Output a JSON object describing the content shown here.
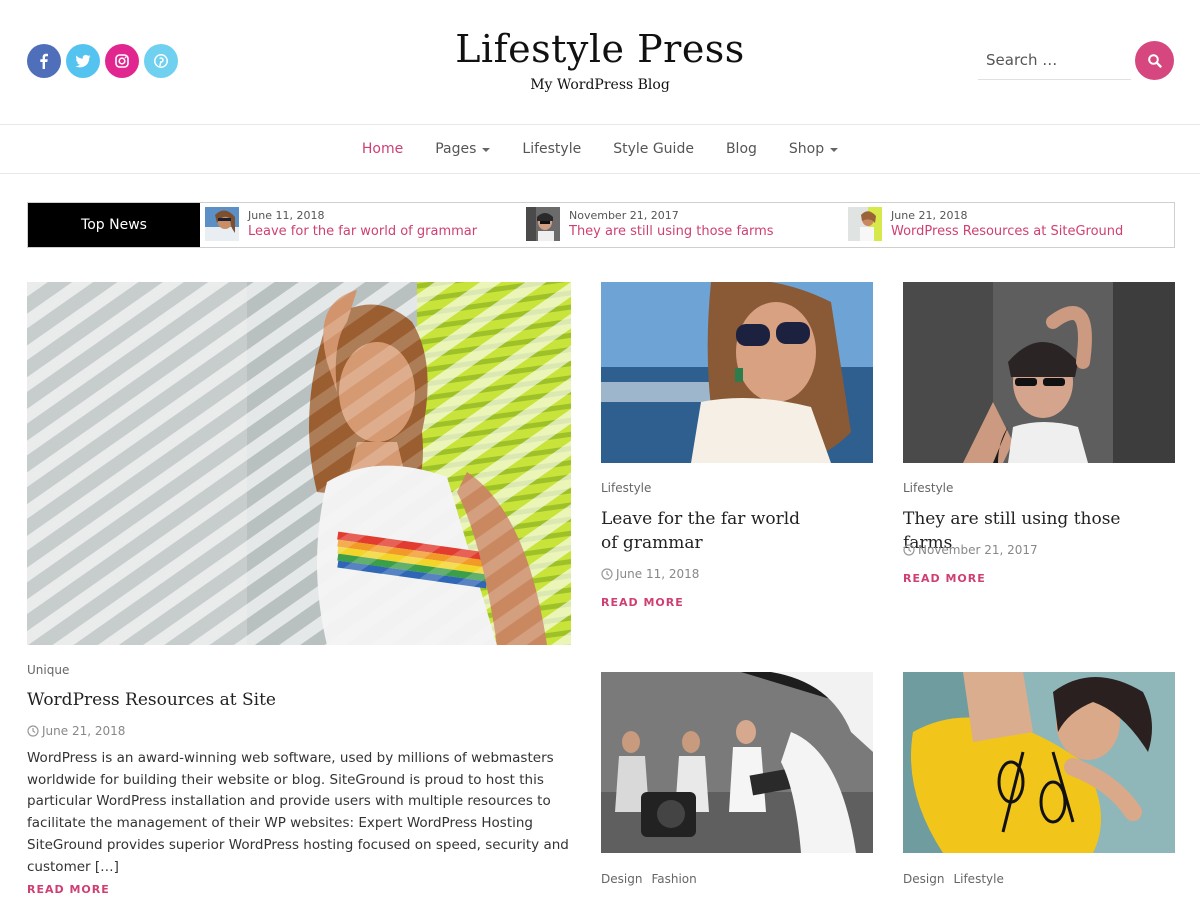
{
  "site": {
    "title": "Lifestyle Press",
    "tagline": "My WordPress Blog"
  },
  "social": [
    "facebook-icon",
    "twitter-icon",
    "instagram-icon",
    "pinterest-icon"
  ],
  "colors": {
    "accent": "#cf3f74",
    "facebook": "#4f6fba",
    "twitter": "#55c3f0",
    "instagram": "#e2268f",
    "pinterest": "#6fd0f0"
  },
  "search": {
    "placeholder": "Search …"
  },
  "nav": [
    "Home",
    "Pages",
    "Lifestyle",
    "Style Guide",
    "Blog",
    "Shop"
  ],
  "ticker": {
    "label": "Top News",
    "items": [
      {
        "date": "June 11, 2018",
        "title": "Leave for the far world of grammar"
      },
      {
        "date": "November 21, 2017",
        "title": "They are still using those farms"
      },
      {
        "date": "June 21, 2018",
        "title": "WordPress Resources at SiteGround"
      }
    ]
  },
  "posts": [
    {
      "category": "Unique",
      "title": "WordPress Resources at Site",
      "date": "June 21, 2018",
      "excerpt": "WordPress is an award-winning web software, used by millions of webmasters worldwide for building their website or blog. SiteGround is proud to host this particular WordPress installation and provide users with multiple resources to facilitate the management of their WP websites: Expert WordPress Hosting SiteGround provides superior WordPress hosting focused on speed, security and customer […]",
      "read_more": "READ MORE"
    },
    {
      "category": "Lifestyle",
      "title": "Leave for the far world of grammar",
      "date": "June 11, 2018",
      "read_more": "READ MORE"
    },
    {
      "category": "Lifestyle",
      "title": "They are still using those farms",
      "date": "November 21, 2017",
      "read_more": "READ MORE"
    },
    {
      "categories": [
        "Design",
        "Fashion"
      ]
    },
    {
      "categories": [
        "Design",
        "Lifestyle"
      ]
    }
  ]
}
